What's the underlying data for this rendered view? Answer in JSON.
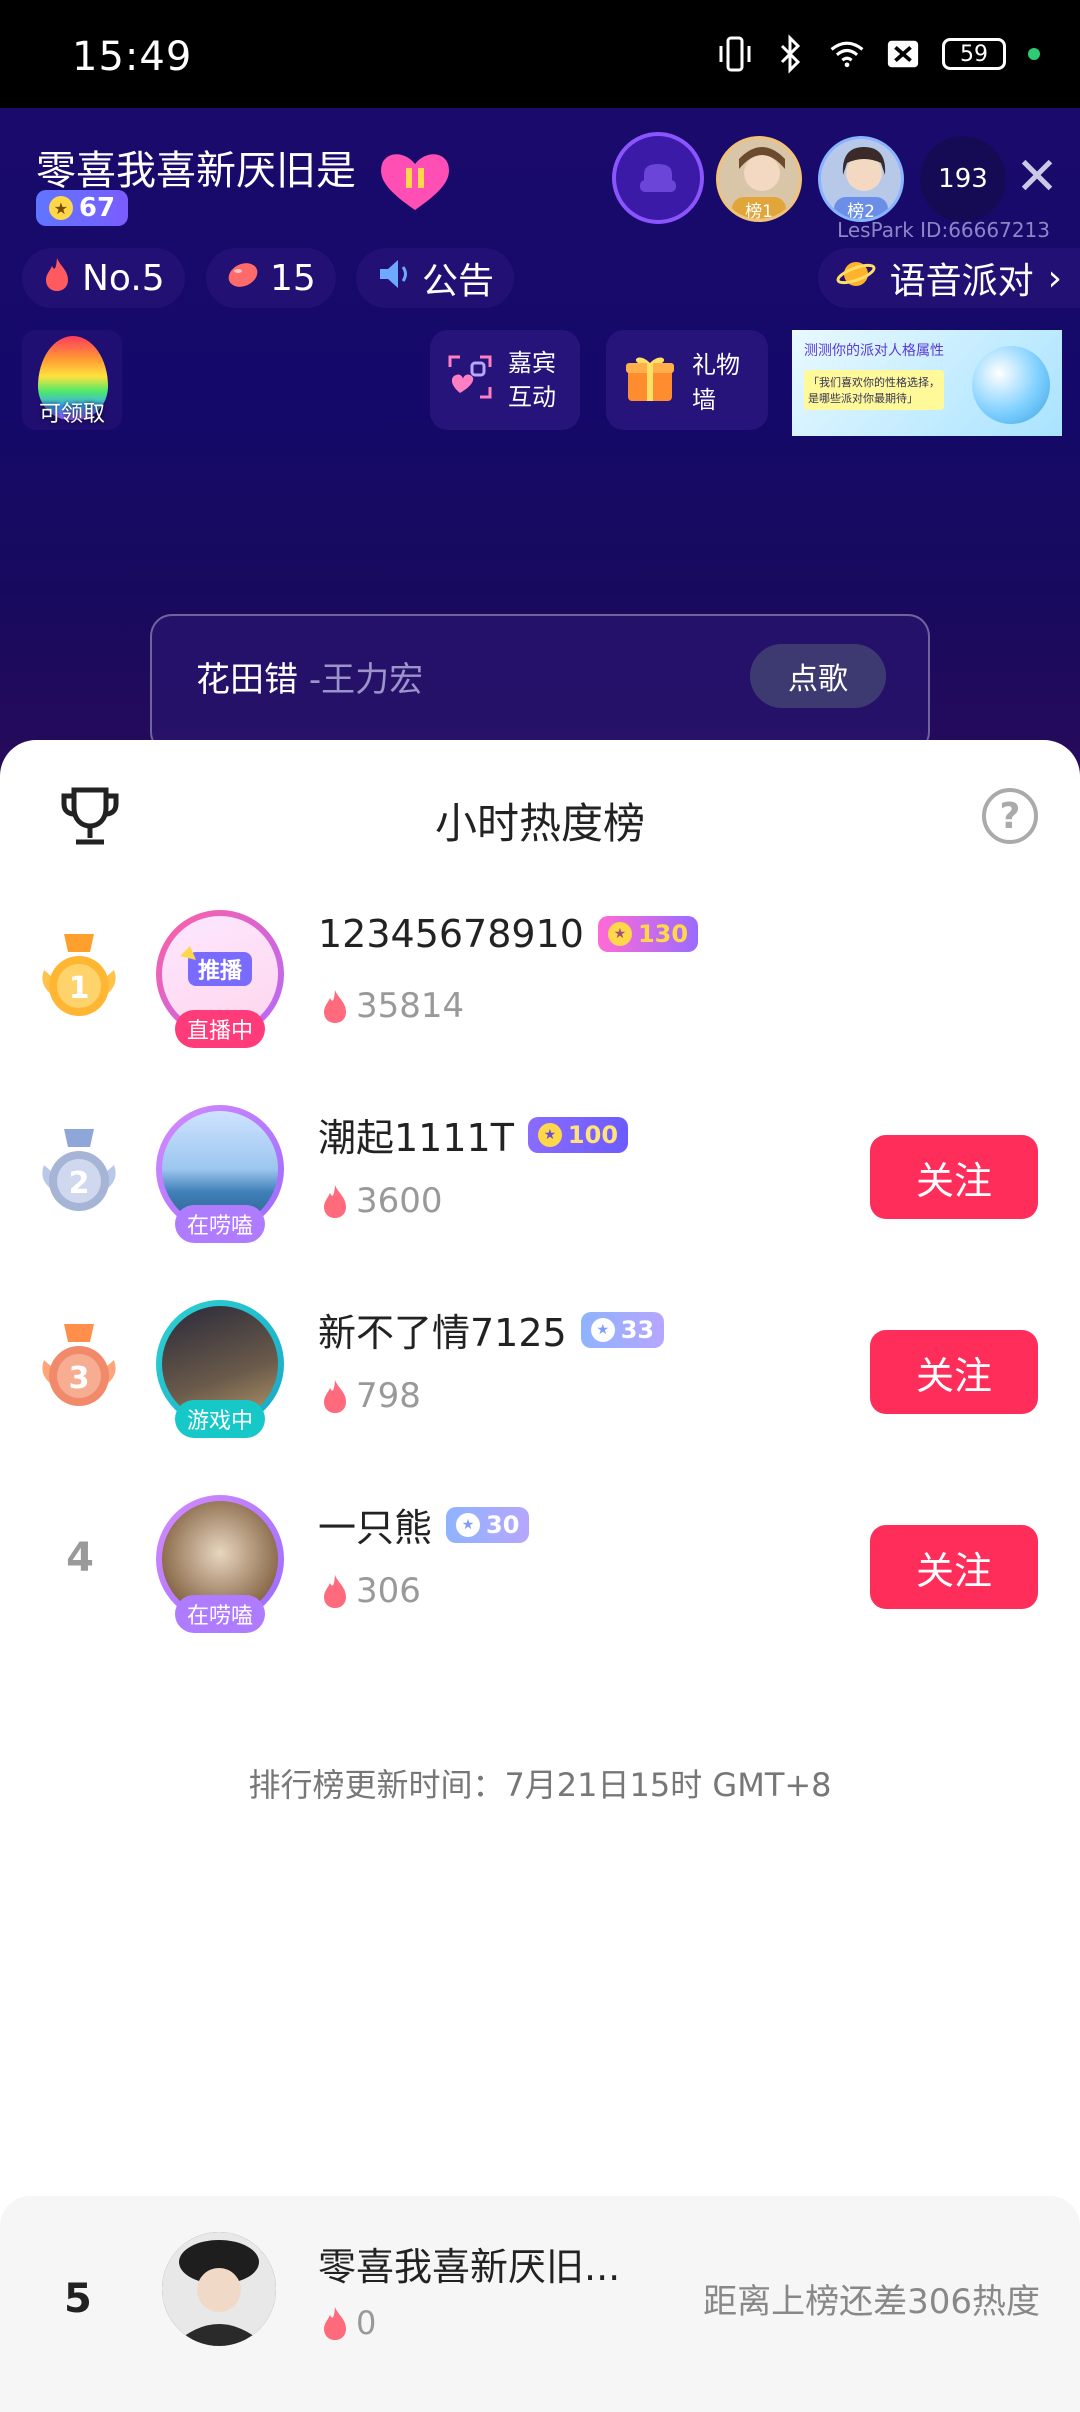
{
  "status_bar": {
    "time": "15:49",
    "battery": "59"
  },
  "room": {
    "title": "零喜我喜新厌旧是你",
    "level": "67",
    "rank1_label": "榜1",
    "rank2_label": "榜2",
    "online_count": "193",
    "room_id": "LesPark ID:66667213",
    "hot_rank": "No.5",
    "beans": "15",
    "notice": "公告",
    "voice_party": "语音派对",
    "egg_label": "可领取",
    "guest_interact": "嘉宾\n互动",
    "gift_wall": "礼物墙",
    "banner_text1": "测测你的派对人格属性",
    "banner_text2": "「我们喜欢你的性格选择，是哪些派对你最期待」",
    "song_title": "花田错",
    "song_artist": "-王力宏",
    "song_button": "点歌"
  },
  "sheet": {
    "title": "小时热度榜",
    "help": "?",
    "rows": [
      {
        "rank": "1",
        "name": "12345678910",
        "level": "130",
        "heat": "35814",
        "status": "直播中",
        "follow": ""
      },
      {
        "rank": "2",
        "name": "潮起1111T",
        "level": "100",
        "heat": "3600",
        "status": "在唠嗑",
        "follow": "关注"
      },
      {
        "rank": "3",
        "name": "新不了情7125",
        "level": "33",
        "heat": "798",
        "status": "游戏中",
        "follow": "关注"
      },
      {
        "rank": "4",
        "name": "一只熊",
        "level": "30",
        "heat": "306",
        "status": "在唠嗑",
        "follow": "关注"
      }
    ],
    "update_time": "排行榜更新时间：7月21日15时 GMT+8"
  },
  "my_rank": {
    "rank": "5",
    "name": "零喜我喜新厌旧...",
    "heat": "0",
    "gap": "距离上榜还差306热度"
  },
  "colors": {
    "follow": "#ff2d5a",
    "live": "#ff3b7a",
    "chat": "#b07cff",
    "game": "#17c8c8",
    "accent_purple": "#8a55ff"
  }
}
